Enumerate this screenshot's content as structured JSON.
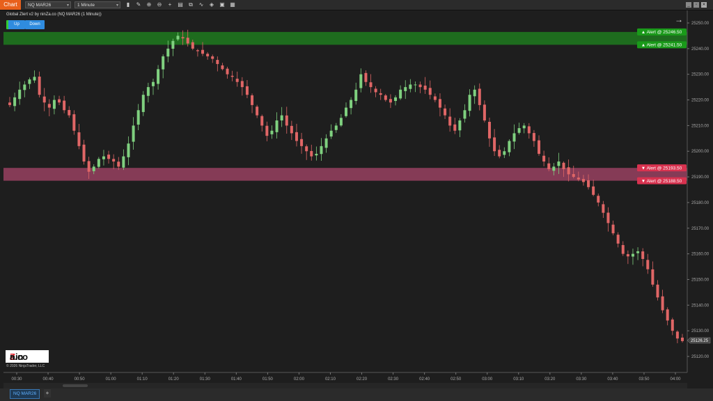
{
  "toolbar": {
    "chart_tab": "Chart",
    "instrument": "NQ MAR26",
    "interval": "1 Minute"
  },
  "indicator": {
    "label": "Global Zlert v2 by ninZa.co (NQ MAR26 (1 Minute))",
    "buttons": [
      "Up",
      "Down"
    ]
  },
  "alerts": [
    {
      "text": "▲ Alert @ 25246.50",
      "price": 25246.5,
      "type": "up",
      "color": "#1a9a1a"
    },
    {
      "text": "▲ Alert @ 25241.50",
      "price": 25241.5,
      "type": "up",
      "color": "#1a9a1a"
    },
    {
      "text": "▼ Alert @ 25193.50",
      "price": 25193.5,
      "type": "down",
      "color": "#d8324f"
    },
    {
      "text": "▼ Alert @ 25188.50",
      "price": 25188.5,
      "type": "down",
      "color": "#d8324f"
    }
  ],
  "current_price": "25126.25",
  "logo": {
    "text_a": "nin",
    "text_z": "Z",
    "text_b": "a.co"
  },
  "copyright": "© 2026 NinjaTrader, LLC",
  "bottom_tabs": {
    "active": "NQ MAR26",
    "add": "+"
  },
  "colors": {
    "up": "#7fd07f",
    "down": "#e06666",
    "up_zone": "#1e7a1e",
    "down_zone": "#b0476e"
  },
  "chart_data": {
    "type": "candlestick",
    "y_ticks": [
      25250,
      25240,
      25230,
      25220,
      25210,
      25200,
      25190,
      25180,
      25170,
      25160,
      25150,
      25140,
      25130,
      25120
    ],
    "y_tick_labels": [
      "25250.00",
      "25240.00",
      "25230.00",
      "25220.00",
      "25210.00",
      "25200.00",
      "25190.00",
      "25180.00",
      "25170.00",
      "25160.00",
      "25150.00",
      "25140.00",
      "25130.00",
      "25120.00"
    ],
    "ylim": [
      25115,
      25255
    ],
    "x_ticks": [
      "00:30",
      "00:40",
      "00:50",
      "01:00",
      "01:10",
      "01:20",
      "01:30",
      "01:40",
      "01:50",
      "02:00",
      "02:10",
      "02:20",
      "02:30",
      "02:40",
      "02:50",
      "03:00",
      "03:10",
      "03:20",
      "03:30",
      "03:40",
      "03:50",
      "04:00"
    ],
    "zones": [
      {
        "type": "up",
        "high": 25246.5,
        "low": 25241.5
      },
      {
        "type": "down",
        "high": 25193.5,
        "low": 25188.5
      }
    ],
    "closes": [
      25218,
      25221,
      25224,
      25226,
      25228,
      25229,
      25222,
      25219,
      25217,
      25220,
      25219,
      25216,
      25214,
      25208,
      25202,
      25196,
      25192,
      25194,
      25197,
      25198,
      25197,
      25196,
      25194,
      25198,
      25203,
      25210,
      25216,
      25222,
      25225,
      25227,
      25232,
      25237,
      25240,
      25243,
      25245,
      25244,
      25242,
      25240,
      25239,
      25238,
      25237,
      25236,
      25234,
      25232,
      25230,
      25229,
      25227,
      25225,
      25222,
      25218,
      25214,
      25210,
      25206,
      25208,
      25212,
      25214,
      25210,
      25207,
      25204,
      25202,
      25200,
      25198,
      25199,
      25202,
      25205,
      25208,
      25210,
      25213,
      25217,
      25220,
      25224,
      25230,
      25227,
      25225,
      25223,
      25222,
      25220,
      25219,
      25221,
      25224,
      25225,
      25226,
      25226,
      25225,
      25224,
      25222,
      25220,
      25217,
      25214,
      25210,
      25208,
      25212,
      25216,
      25222,
      25224,
      25218,
      25212,
      25205,
      25200,
      25198,
      25200,
      25204,
      25207,
      25209,
      25210,
      25207,
      25204,
      25199,
      25196,
      25193,
      25194,
      25196,
      25193,
      25191,
      25190,
      25189,
      25188,
      25186,
      25183,
      25180,
      25176,
      25172,
      25168,
      25164,
      25160,
      25159,
      25160,
      25161,
      25158,
      25154,
      25148,
      25143,
      25138,
      25134,
      25130,
      25127,
      25126
    ],
    "current_price": 25126.25
  }
}
